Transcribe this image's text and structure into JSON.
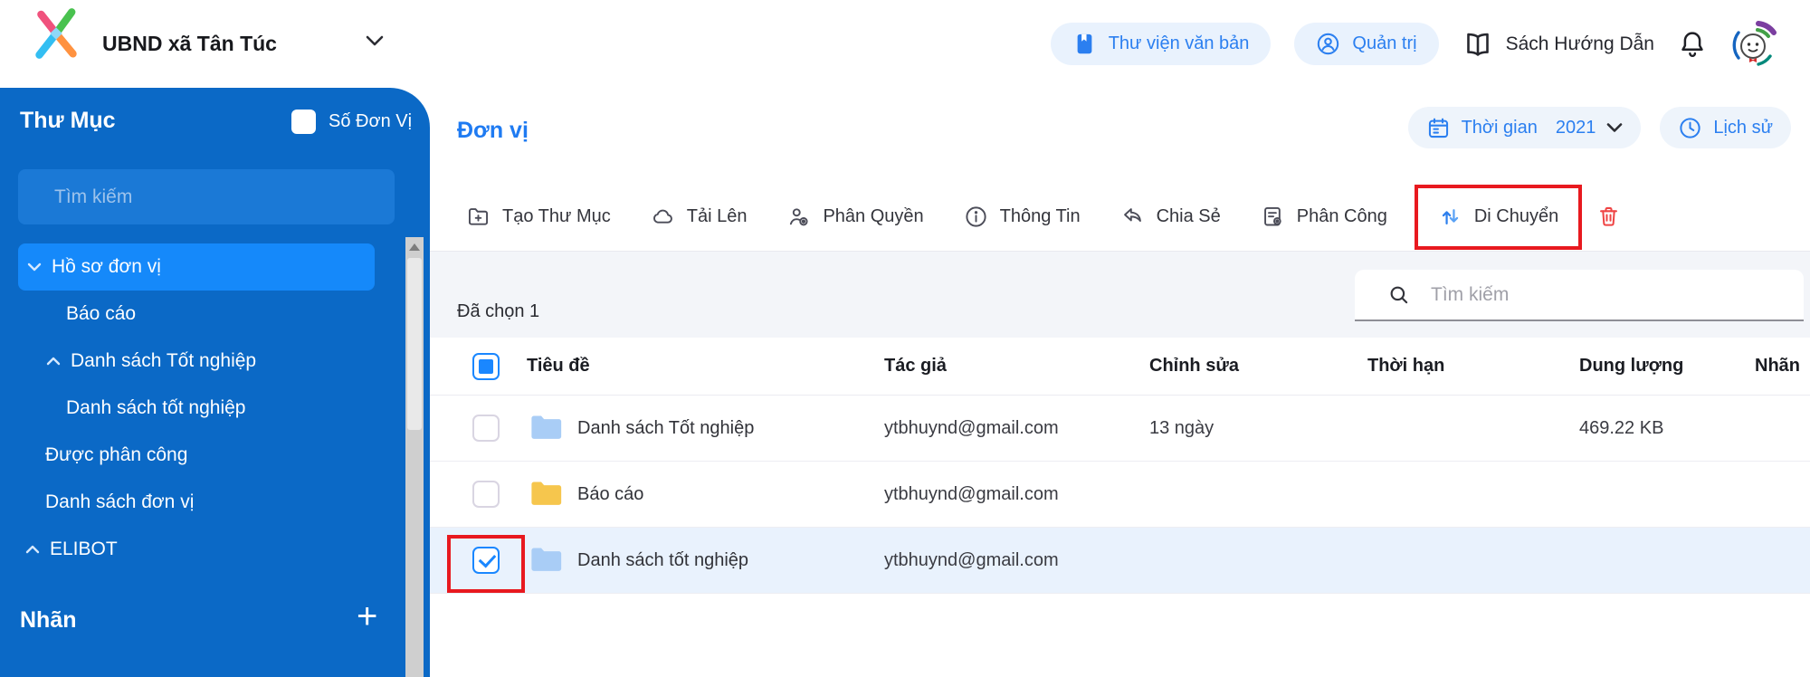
{
  "header": {
    "org_name": "UBND xã Tân Túc",
    "library_label": "Thư viện văn bản",
    "admin_label": "Quản trị",
    "guide_label": "Sách Hướng Dẫn"
  },
  "sidebar": {
    "title": "Thư Mục",
    "unit_toggle_label": "Số Đơn Vị",
    "search_placeholder": "Tìm kiếm",
    "tree": [
      {
        "label": "Hồ sơ đơn vị"
      },
      {
        "label": "Báo cáo"
      },
      {
        "label": "Danh sách Tốt nghiệp"
      },
      {
        "label": "Danh sách tốt nghiệp"
      },
      {
        "label": "Được phân công"
      },
      {
        "label": "Danh sách đơn vị"
      },
      {
        "label": "ELIBOT"
      }
    ],
    "labels_title": "Nhãn",
    "add_button": "+"
  },
  "main": {
    "title": "Đơn vị",
    "time_filter": {
      "label": "Thời gian",
      "value": "2021"
    },
    "history_label": "Lịch sử",
    "toolbar": {
      "create_folder": "Tạo Thư Mục",
      "upload": "Tải Lên",
      "permission": "Phân Quyền",
      "info": "Thông Tin",
      "share": "Chia Sẻ",
      "assign": "Phân Công",
      "move": "Di Chuyển"
    },
    "selection_status": "Đã chọn 1",
    "search_placeholder": "Tìm kiếm",
    "table": {
      "columns": {
        "title": "Tiêu đề",
        "author": "Tác giả",
        "edited": "Chỉnh sửa",
        "term": "Thời hạn",
        "size": "Dung lượng",
        "label": "Nhãn"
      },
      "rows": [
        {
          "title": "Danh sách Tốt nghiệp",
          "author": "ytbhuynd@gmail.com",
          "edited": "13 ngày",
          "term": "",
          "size": "469.22 KB",
          "folder_color": "#a9cdf6"
        },
        {
          "title": "Báo cáo",
          "author": "ytbhuynd@gmail.com",
          "edited": "",
          "term": "",
          "size": "",
          "folder_color": "#f6c64d"
        },
        {
          "title": "Danh sách tốt nghiệp",
          "author": "ytbhuynd@gmail.com",
          "edited": "",
          "term": "",
          "size": "",
          "folder_color": "#a9cdf6"
        }
      ]
    }
  },
  "colors": {
    "accent": "#2b7ff0",
    "sidebar": "#0b69c6",
    "selected_item": "#1589fa",
    "selected_row": "#e9f2fd",
    "danger": "#ef4444",
    "annotation": "#e8191f"
  }
}
